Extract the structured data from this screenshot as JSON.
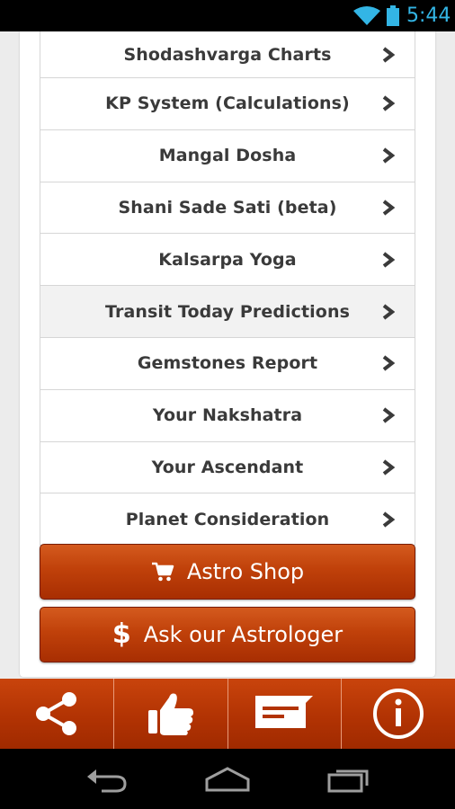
{
  "status_bar": {
    "time": "5:44",
    "icons": [
      "wifi-icon",
      "battery-icon"
    ]
  },
  "menu": {
    "items": [
      {
        "label": "Shodashvarga Charts"
      },
      {
        "label": "KP System (Calculations)"
      },
      {
        "label": "Mangal Dosha"
      },
      {
        "label": "Shani Sade Sati (beta)"
      },
      {
        "label": "Kalsarpa Yoga"
      },
      {
        "label": "Transit Today Predictions",
        "highlighted": true
      },
      {
        "label": "Gemstones Report"
      },
      {
        "label": "Your Nakshatra"
      },
      {
        "label": "Your Ascendant"
      },
      {
        "label": "Planet Consideration"
      }
    ]
  },
  "buttons": {
    "astro_shop": {
      "label": "Astro Shop",
      "icon": "cart-icon"
    },
    "ask_astrologer": {
      "label": "Ask our Astrologer",
      "icon_text": "$"
    }
  },
  "tabbar": {
    "tabs": [
      {
        "icon": "share-icon"
      },
      {
        "icon": "thumbs-up-icon"
      },
      {
        "icon": "message-icon"
      },
      {
        "icon": "info-icon"
      }
    ]
  },
  "navbar": {
    "buttons": [
      "back-icon",
      "home-icon",
      "recent-apps-icon"
    ]
  },
  "colors": {
    "accent": "#c0410a",
    "status_text": "#33b5e5",
    "menu_text": "#3a3a3a"
  }
}
